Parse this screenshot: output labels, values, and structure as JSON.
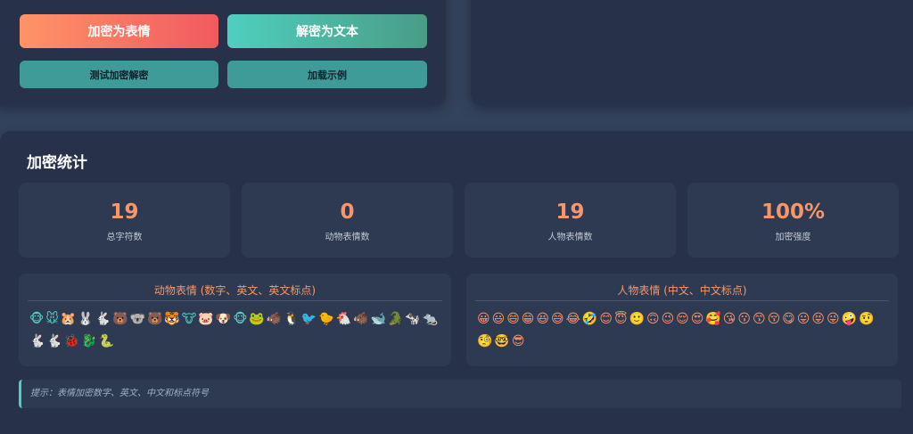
{
  "controls": {
    "encrypt_label": "加密为表情",
    "decrypt_label": "解密为文本",
    "test_label": "测试加密解密",
    "example_label": "加载示例"
  },
  "stats": {
    "title": "加密统计",
    "cards": [
      {
        "value": "19",
        "label": "总字符数"
      },
      {
        "value": "0",
        "label": "动物表情数"
      },
      {
        "value": "19",
        "label": "人物表情数"
      },
      {
        "value": "100%",
        "label": "加密强度"
      }
    ]
  },
  "animal_box": {
    "title": "动物表情 (数字、英文、英文标点)",
    "emojis": "🐵🐭🐹🐰🐇🐻🐨🐻🐯🐮🐷🐶🐵🐸🐗🐧🐦🐤🐔🐗🐋🐊🐄🐀🐇🐇🐞🐉🐍"
  },
  "person_box": {
    "title": "人物表情 (中文、中文标点)",
    "emojis": "😀😃😄😁😆😅😂🤣😊😇🙂🙃😉😌😍🥰😘😗😙😚😋😛😝😜🤪🤨🧐🤓😎"
  },
  "hint": "提示：表情加密数字、英文、中文和标点符号",
  "colors": {
    "accent_orange": "#f6966a",
    "accent_teal": "#4ecfbf",
    "panel_bg": "#27324a"
  }
}
